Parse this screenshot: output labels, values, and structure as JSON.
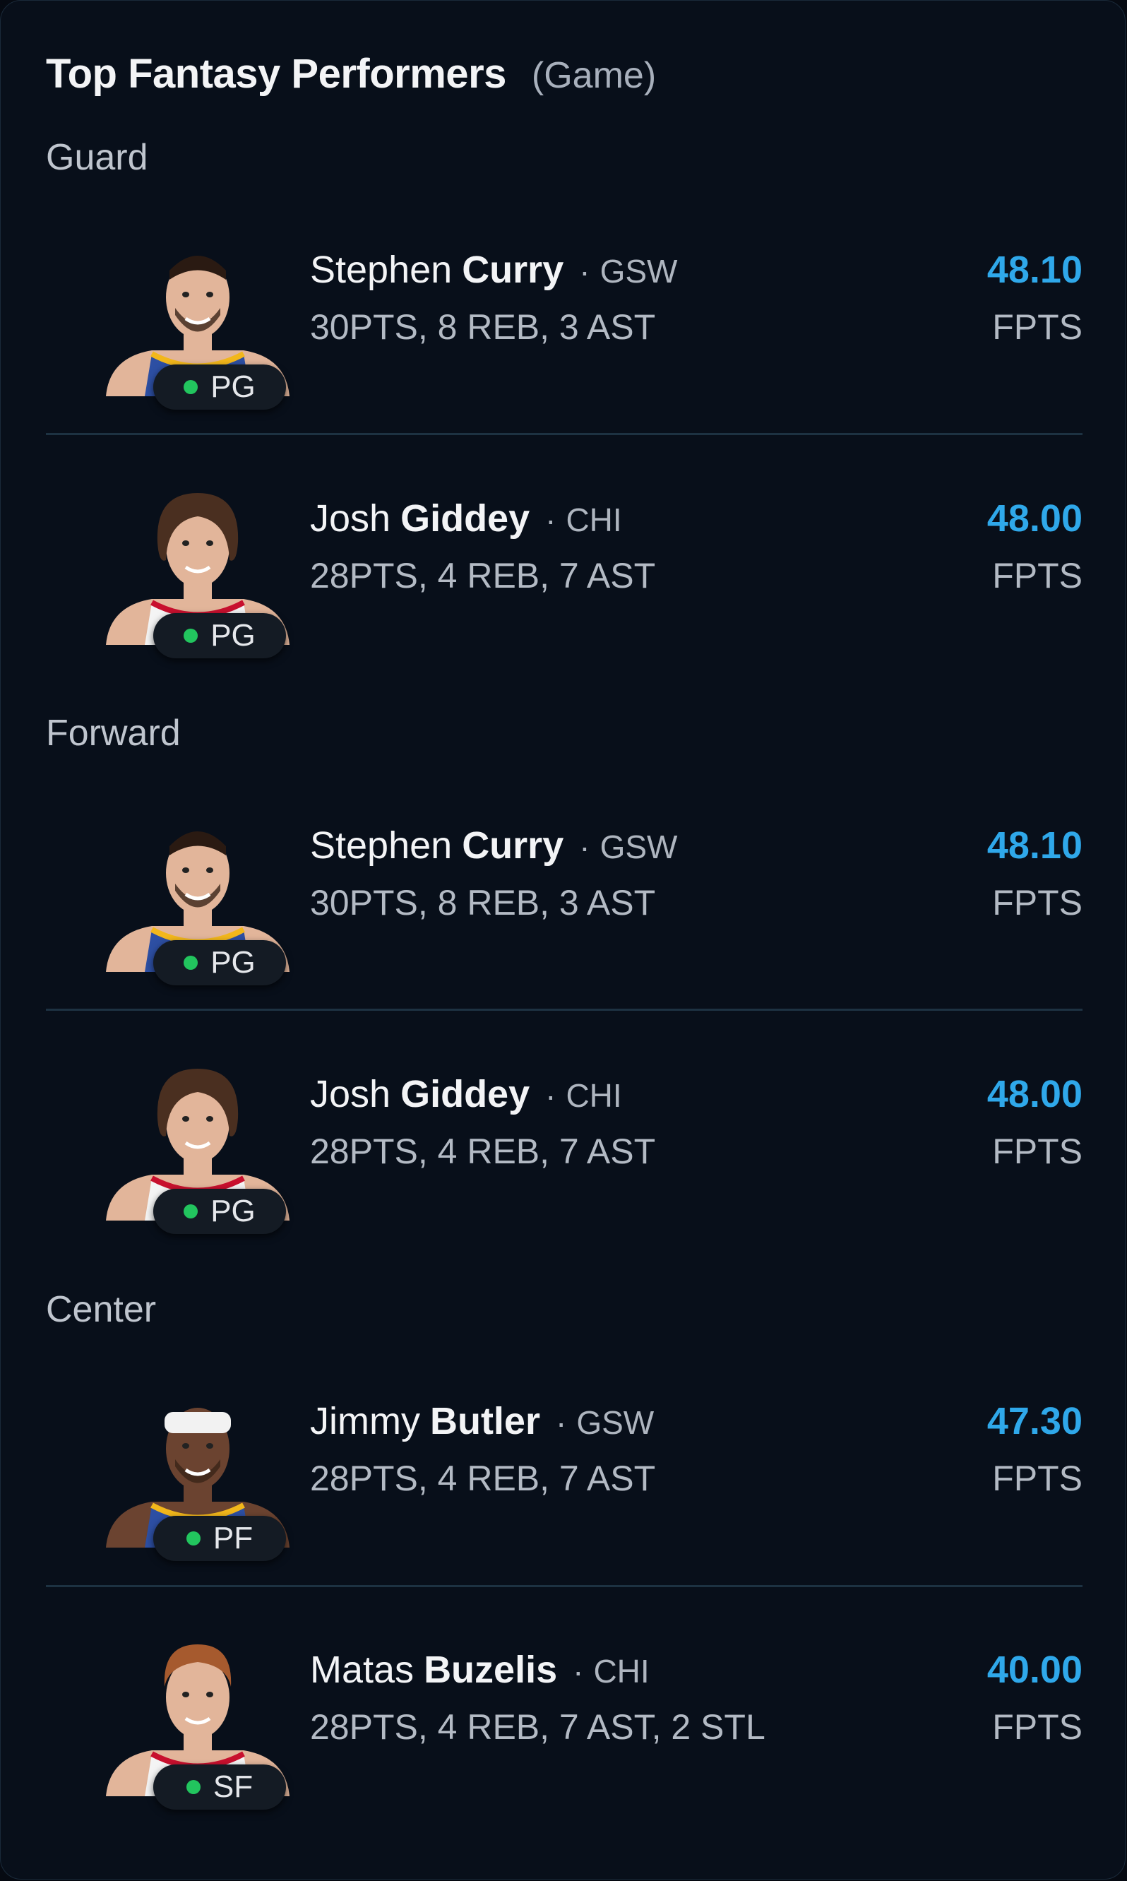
{
  "header": {
    "title": "Top Fantasy Performers",
    "subtitle": "(Game)"
  },
  "colors": {
    "accent": "#2fa8ea",
    "status_dot": "#22c55e",
    "background": "#080f1a"
  },
  "sections": [
    {
      "label": "Guard",
      "players": [
        {
          "first": "Stephen",
          "last": "Curry",
          "separator": "·",
          "team": "GSW",
          "stats": "30PTS, 8 REB, 3 AST",
          "score": "48.10",
          "unit": "FPTS",
          "position": "PG",
          "jersey": "gsw",
          "hair": "short",
          "headband": false
        },
        {
          "first": "Josh",
          "last": "Giddey",
          "separator": "·",
          "team": "CHI",
          "stats": "28PTS, 4 REB, 7 AST",
          "score": "48.00",
          "unit": "FPTS",
          "position": "PG",
          "jersey": "chi",
          "hair": "long",
          "headband": false
        }
      ]
    },
    {
      "label": "Forward",
      "players": [
        {
          "first": "Stephen",
          "last": "Curry",
          "separator": "·",
          "team": "GSW",
          "stats": "30PTS, 8 REB, 3 AST",
          "score": "48.10",
          "unit": "FPTS",
          "position": "PG",
          "jersey": "gsw",
          "hair": "short",
          "headband": false
        },
        {
          "first": "Josh",
          "last": "Giddey",
          "separator": "·",
          "team": "CHI",
          "stats": "28PTS, 4 REB, 7 AST",
          "score": "48.00",
          "unit": "FPTS",
          "position": "PG",
          "jersey": "chi",
          "hair": "long",
          "headband": false
        }
      ]
    },
    {
      "label": "Center",
      "players": [
        {
          "first": "Jimmy",
          "last": "Butler",
          "separator": "·",
          "team": "GSW",
          "stats": "28PTS, 4 REB, 7 AST",
          "score": "47.30",
          "unit": "FPTS",
          "position": "PF",
          "jersey": "gsw",
          "hair": "none",
          "headband": true
        },
        {
          "first": "Matas",
          "last": "Buzelis",
          "separator": "·",
          "team": "CHI",
          "stats": "28PTS, 4 REB, 7 AST, 2 STL",
          "score": "40.00",
          "unit": "FPTS",
          "position": "SF",
          "jersey": "chi",
          "hair": "red",
          "headband": false
        }
      ]
    }
  ]
}
